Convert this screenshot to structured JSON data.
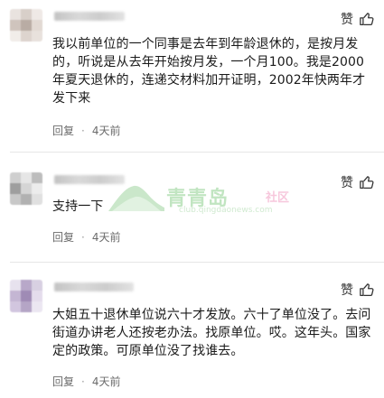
{
  "comments": [
    {
      "like_label": "赞",
      "text": "我以前单位的一个同事是去年到年龄退休的，是按月发的，听说是从去年开始按月发，一个月100。我是2000年夏天退休的，连递交材料加开证明，2002年快两年才发下来",
      "reply_label": "回复",
      "dot": "·",
      "time": "4天前"
    },
    {
      "like_label": "赞",
      "text": "支持一下",
      "reply_label": "回复",
      "dot": "·",
      "time": "4天前"
    },
    {
      "like_label": "赞",
      "text": "大姐五十退休单位说六十才发放。六十了单位没了。去问街道办讲老人还按老办法。找原单位。哎。这年头。国家定的政策。可原单位没了找谁去。",
      "reply_label": "回复",
      "dot": "·",
      "time": "4天前"
    }
  ],
  "watermark": {
    "title": "青青岛",
    "tag": "社区",
    "subtitle": "club.qingdaonews.com"
  },
  "colors": {
    "avatar1": [
      "#e9e3df",
      "#d8cfc9",
      "#efe9e6",
      "#cfc4bd",
      "#b9aca4",
      "#e2d9d3",
      "#f1ede9",
      "#ddd4ce",
      "#e8e1dc"
    ],
    "avatar2": [
      "#cfcfcf",
      "#e6e6e6",
      "#bdbdbd",
      "#9e9e9e",
      "#d5d5d5",
      "#ececec",
      "#c8c8c8",
      "#b1b1b1",
      "#e0e0e0"
    ],
    "avatar3": [
      "#e7e2ee",
      "#b8a8c9",
      "#d8d0e2",
      "#c4b6d3",
      "#9f8bb5",
      "#e4dcec",
      "#d2c6df",
      "#b5a5c6",
      "#ebe6f1"
    ]
  }
}
